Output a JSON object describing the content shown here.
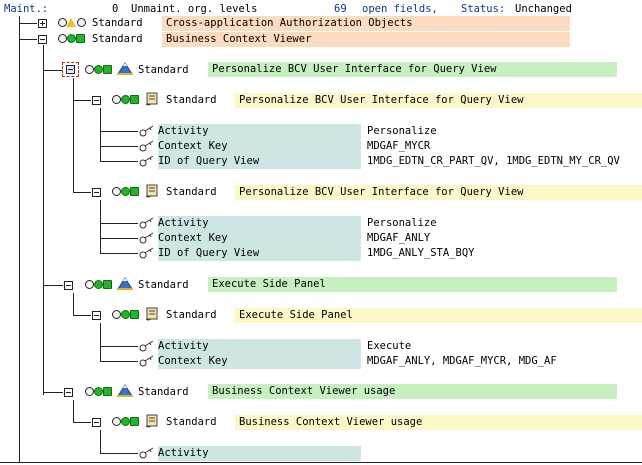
{
  "status_bar": {
    "maint_label": "Maint.:",
    "unmaint_count": "0",
    "unmaint_label": "Unmaint. org. levels",
    "open_count": "69",
    "open_label": "open fields,",
    "status_label": "Status:",
    "status_value": "Unchanged"
  },
  "tree": {
    "n1": {
      "variant": "Standard",
      "title": "Cross-application Authorization Objects"
    },
    "n2": {
      "variant": "Standard",
      "title": "Business Context Viewer"
    },
    "n3": {
      "variant": "Standard",
      "title": "Personalize BCV User Interface for Query View"
    },
    "n3a": {
      "variant": "Standard",
      "title": "Personalize BCV User Interface for Query View",
      "fields": [
        {
          "label": "Activity",
          "value": "Personalize"
        },
        {
          "label": "Context Key",
          "value": "MDGAF_MYCR"
        },
        {
          "label": "ID of Query View",
          "value": "1MDG_EDTN_CR_PART_QV, 1MDG_EDTN_MY_CR_QV"
        }
      ]
    },
    "n3b": {
      "variant": "Standard",
      "title": "Personalize BCV User Interface for Query View",
      "fields": [
        {
          "label": "Activity",
          "value": "Personalize"
        },
        {
          "label": "Context Key",
          "value": "MDGAF_ANLY"
        },
        {
          "label": "ID of Query View",
          "value": "1MDG_ANLY_STA_BQY"
        }
      ]
    },
    "n4": {
      "variant": "Standard",
      "title": "Execute Side Panel"
    },
    "n4a": {
      "variant": "Standard",
      "title": "Execute Side Panel",
      "fields": [
        {
          "label": "Activity",
          "value": "Execute"
        },
        {
          "label": "Context Key",
          "value": "MDGAF_ANLY, MDGAF_MYCR, MDG_AF"
        }
      ]
    },
    "n5": {
      "variant": "Standard",
      "title": "Business Context Viewer usage"
    },
    "n5a": {
      "variant": "Standard",
      "title": "Business Context Viewer usage",
      "fields": [
        {
          "label": "Activity",
          "value": ""
        }
      ]
    }
  }
}
